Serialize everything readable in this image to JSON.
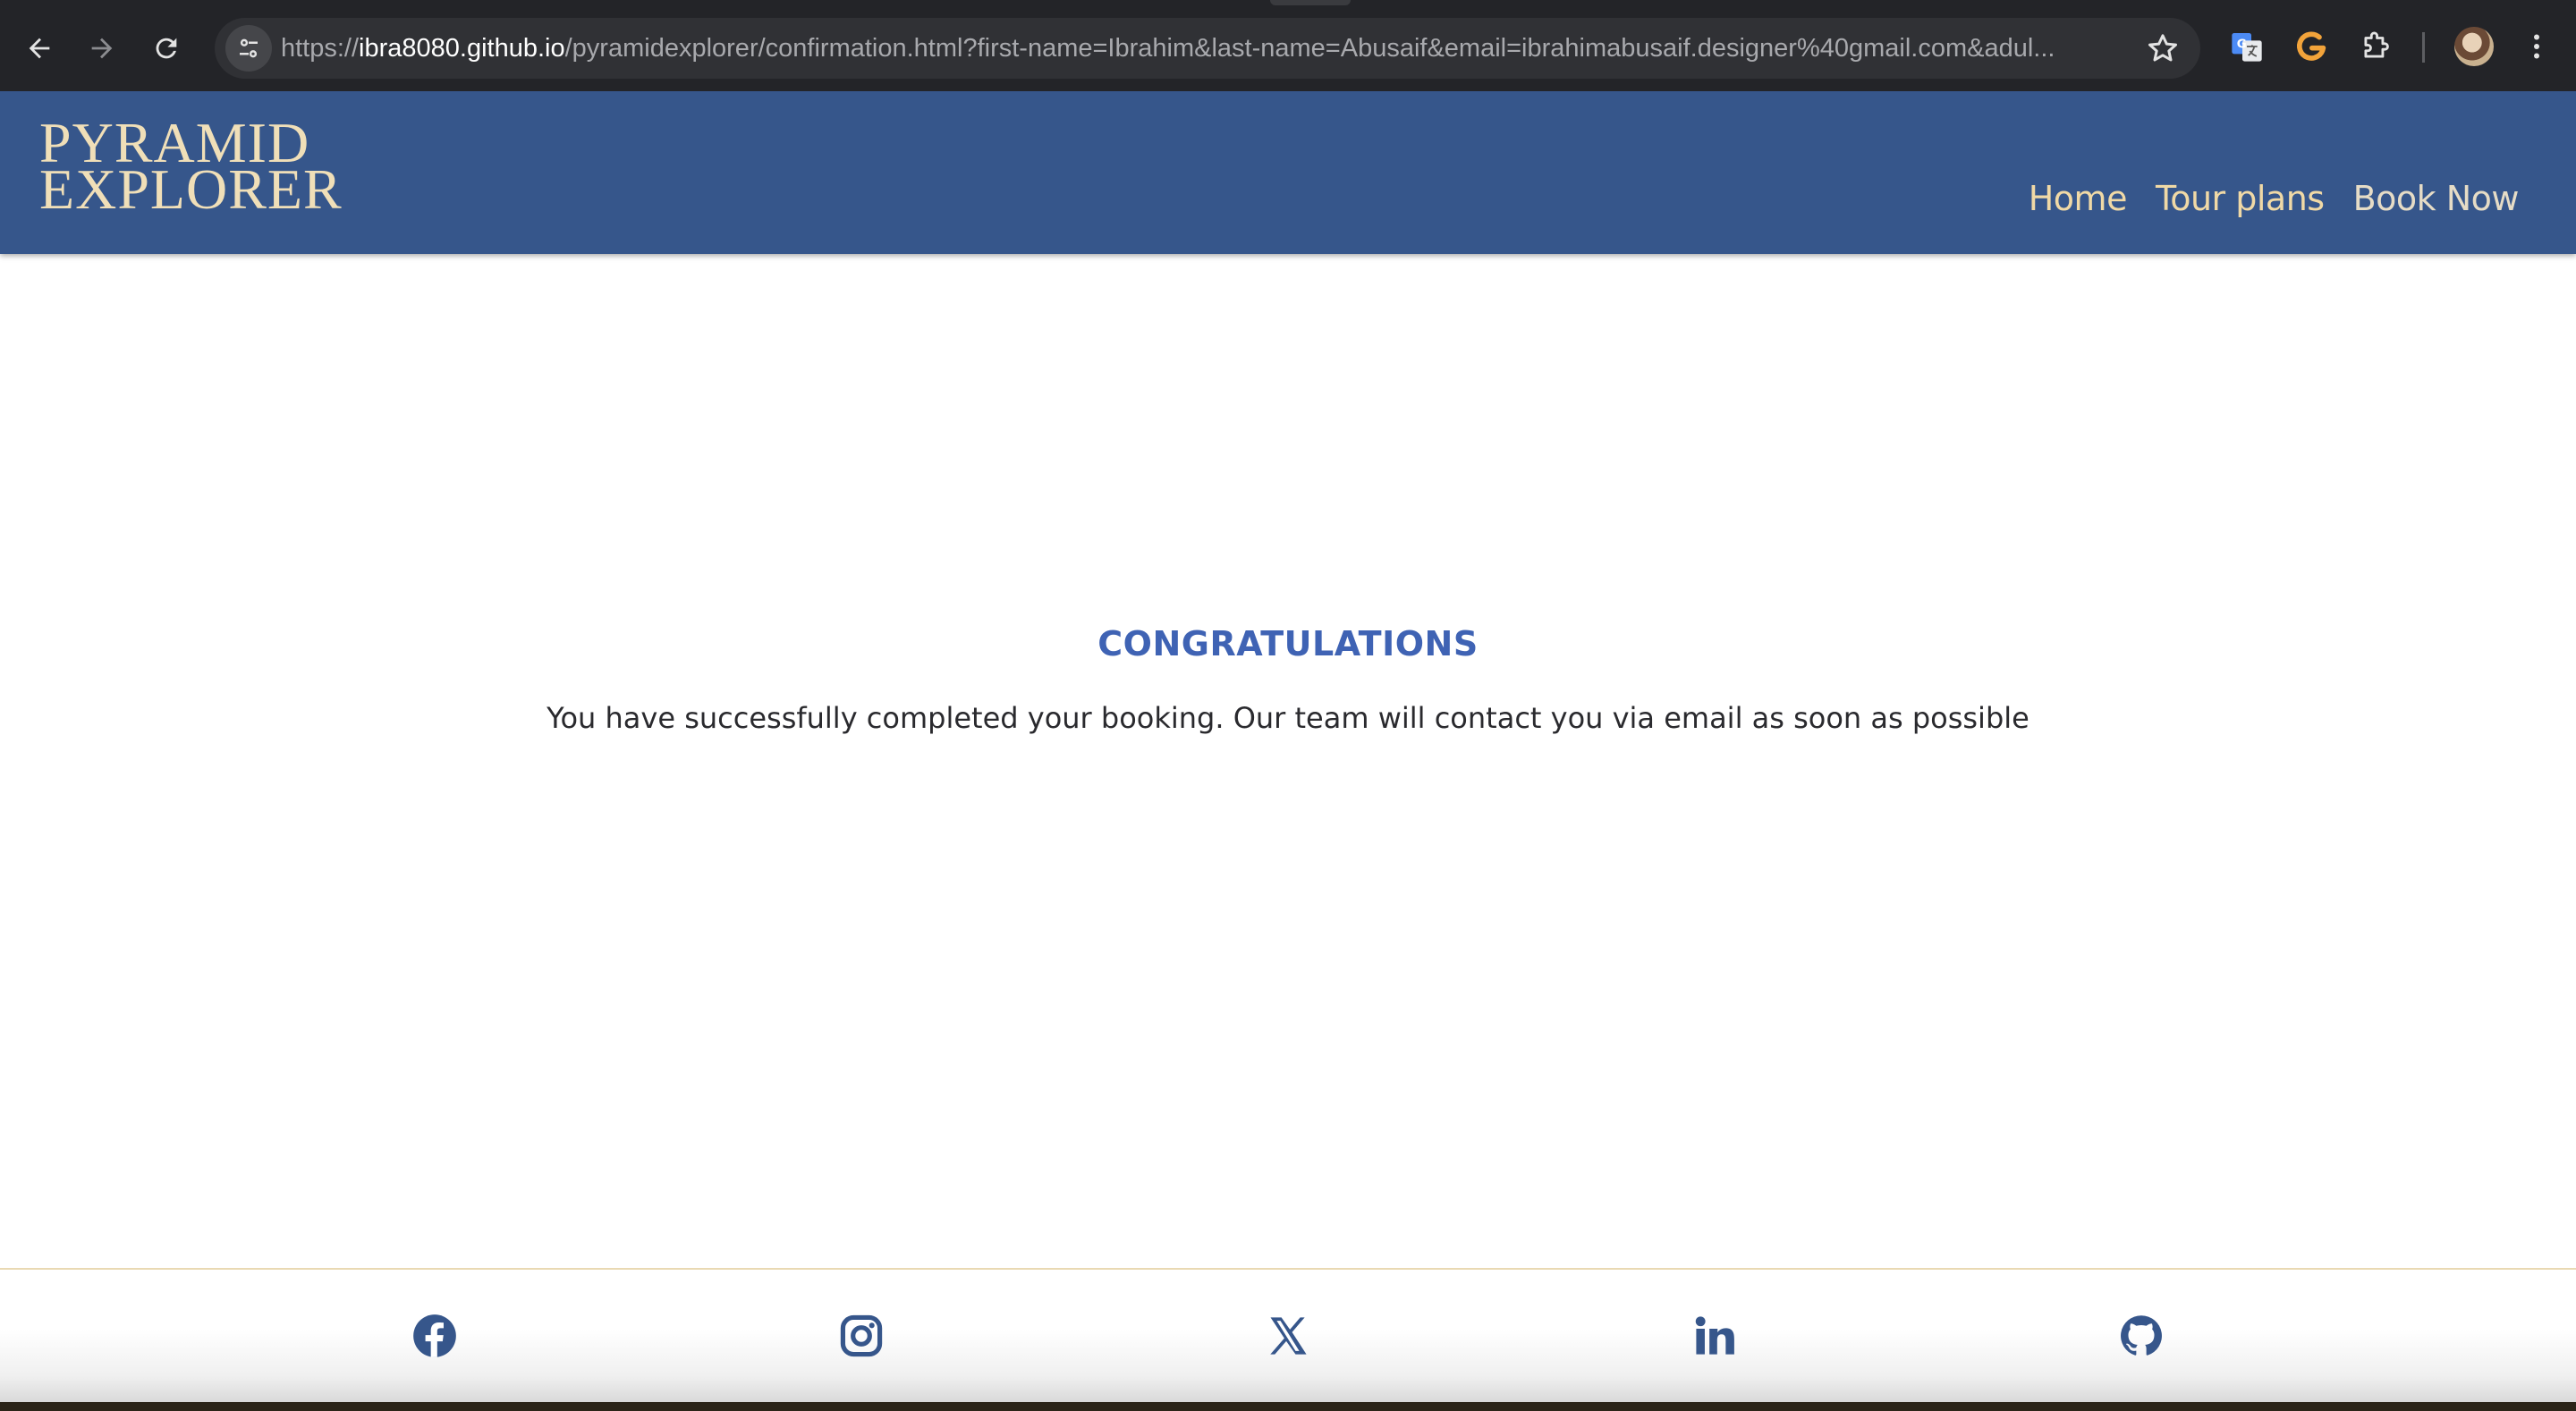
{
  "browser": {
    "url_prefix": "https://",
    "url_host": "ibra8080.github.io",
    "url_rest": "/pyramidexplorer/confirmation.html?first-name=Ibrahim&last-name=Abusaif&email=ibrahimabusaif.designer%40gmail.com&adul..."
  },
  "header": {
    "logo_line1": "PYRAMID",
    "logo_line2": "EXPLORER",
    "nav": {
      "home": "Home",
      "tour_plans": "Tour plans",
      "book_now": "Book Now"
    }
  },
  "main": {
    "heading": "CONGRATULATIONS",
    "message": "You have successfully completed your booking. Our team will contact you via email as soon as possible"
  },
  "footer": {
    "icons": [
      "facebook-icon",
      "instagram-icon",
      "x-icon",
      "linkedin-icon",
      "github-icon"
    ],
    "icon_color": "#36568b"
  },
  "colors": {
    "header_bg": "#36568b",
    "nav_text": "#f0d9a6",
    "heading": "#3f63b4",
    "footer_border": "#e9d9b3"
  }
}
